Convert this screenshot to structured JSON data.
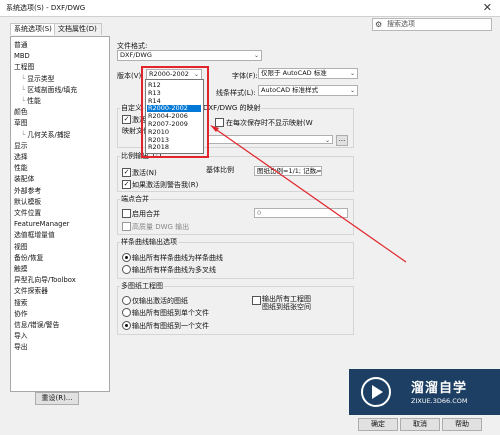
{
  "window": {
    "title": "系统选项(S) - DXF/DWG"
  },
  "tabs": [
    "系统选项(S)",
    "文档属性(D)"
  ],
  "search": {
    "placeholder": "搜索选项"
  },
  "tree": [
    {
      "label": "普通",
      "level": 0
    },
    {
      "label": "MBD",
      "level": 0
    },
    {
      "label": "工程图",
      "level": 0
    },
    {
      "label": "显示类型",
      "level": 1
    },
    {
      "label": "区域剖面线/填充",
      "level": 1
    },
    {
      "label": "性能",
      "level": 1
    },
    {
      "label": "颜色",
      "level": 0
    },
    {
      "label": "草图",
      "level": 0
    },
    {
      "label": "几何关系/捕捉",
      "level": 1
    },
    {
      "label": "显示",
      "level": 0
    },
    {
      "label": "选择",
      "level": 0
    },
    {
      "label": "性能",
      "level": 0
    },
    {
      "label": "装配体",
      "level": 0
    },
    {
      "label": "外部参考",
      "level": 0
    },
    {
      "label": "默认模板",
      "level": 0
    },
    {
      "label": "文件位置",
      "level": 0
    },
    {
      "label": "FeatureManager",
      "level": 0
    },
    {
      "label": "选值框增量值",
      "level": 0
    },
    {
      "label": "视图",
      "level": 0
    },
    {
      "label": "备份/恢复",
      "level": 0
    },
    {
      "label": "触摸",
      "level": 0
    },
    {
      "label": "异型孔向导/Toolbox",
      "level": 0
    },
    {
      "label": "文件探索器",
      "level": 0
    },
    {
      "label": "搜索",
      "level": 0
    },
    {
      "label": "协作",
      "level": 0
    },
    {
      "label": "信息/错误/警告",
      "level": 0
    },
    {
      "label": "导入",
      "level": 0
    },
    {
      "label": "导出",
      "level": 0
    }
  ],
  "reset_label": "重设(R)...",
  "format": {
    "label": "文件格式:",
    "value": "DXF/DWG"
  },
  "version": {
    "label": "版本(V):",
    "value": "R2000-2002",
    "options": [
      "R12",
      "R13",
      "R14",
      "R2000-2002",
      "R2004-2006",
      "R2007-2009",
      "R2010",
      "R2013",
      "R2018"
    ],
    "selected_index": 3
  },
  "font": {
    "label": "字体(F):",
    "value": "仅限于 AutoCAD 标准"
  },
  "linestyle": {
    "label": "线条样式(L):",
    "value": "AutoCAD 标准样式"
  },
  "mapping": {
    "title_left": "自定义",
    "title_right": "DXF/DWG 的映射",
    "activate_left": "激活",
    "prompt_right": "在每次保存时不显示映射(W",
    "file_left": "映射文件",
    "browse_label": "..."
  },
  "scale": {
    "group_title": "比例输出 1:1",
    "enable_label": "激活(N)",
    "base_label": "基体比例",
    "base_value": "图纸比例=1/1; 记数=1",
    "warn_label": "如果激活则警告我(R)"
  },
  "merge": {
    "group_title": "端点合并",
    "enable_label": "启用合并",
    "hq_label": "高质量 DWG 输出",
    "value": "0"
  },
  "spline": {
    "group_title": "样条曲线输出选项",
    "opt1": "输出所有样条曲线为样条曲线",
    "opt2": "输出所有样条曲线为多叉线"
  },
  "multisheet": {
    "group_title": "多图纸工程图",
    "opt1": "仅输出激活的图纸",
    "opt2": "输出所有图纸到单个文件",
    "opt3": "输出所有图纸到一个文件",
    "cb_line1": "输出所有工程图",
    "cb_line2": "图纸到纸张空间"
  },
  "buttons": {
    "ok": "确定",
    "cancel": "取消",
    "help": "帮助"
  },
  "watermark": {
    "text": "溜溜自学",
    "url": "ZIXUE.3D66.COM"
  },
  "colors": {
    "accent": "#0078d7",
    "annotation": "#e0262c",
    "logo_bg": "#1d3f63"
  }
}
